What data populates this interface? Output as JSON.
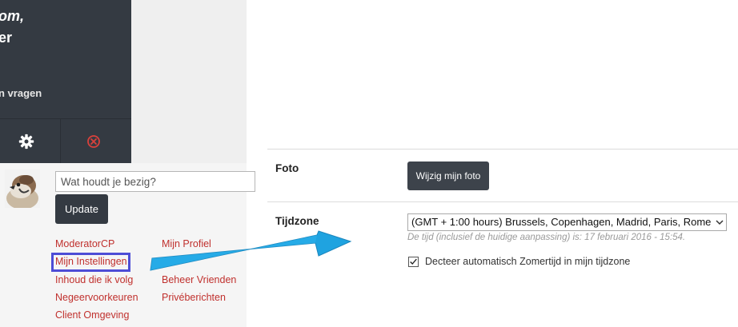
{
  "user_panel": {
    "line1": "om,",
    "line2": "er",
    "line3": "n vragen",
    "settings_icon": "gear-icon",
    "logout_icon": "close-circle-icon"
  },
  "status": {
    "placeholder": "Wat houdt je bezig?",
    "update_label": "Update"
  },
  "links": {
    "column1": [
      "ModeratorCP",
      "Mijn Instellingen",
      "Inhoud die ik volg",
      "Negeervoorkeuren",
      "Client Omgeving"
    ],
    "column2": [
      "Mijn Profiel",
      "",
      "Beheer Vrienden",
      "Privéberichten"
    ]
  },
  "settings": {
    "photo": {
      "label": "Foto",
      "button_label": "Wijzig mijn foto"
    },
    "timezone": {
      "label": "Tijdzone",
      "selected": "(GMT + 1:00 hours) Brussels, Copenhagen, Madrid, Paris, Rome",
      "hint": "De tijd (inclusief de huidige aanpassing) is: 17 februari 2016 - 15:54.",
      "dst_checked": true,
      "dst_label": "Decteer automatisch Zomertijd in mijn tijdzone"
    }
  },
  "colors": {
    "dark_panel": "#343a42",
    "link": "#c0302d",
    "highlight": "#4d4dd6",
    "arrow": "#1fa3e0"
  }
}
